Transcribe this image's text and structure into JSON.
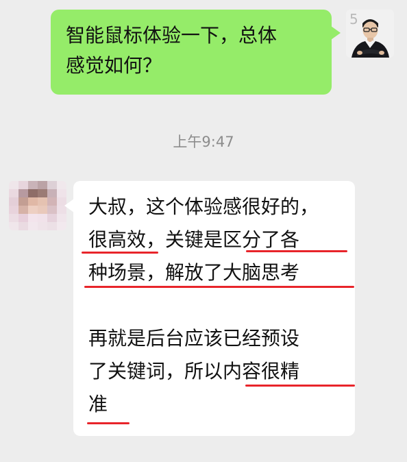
{
  "messages": {
    "outgoing": {
      "lines": [
        "智能鼠标体验一下，总体",
        "感觉如何？"
      ],
      "avatar_badge": "5"
    },
    "timestamp": "上午9:47",
    "incoming": {
      "lines": [
        "大叔，这个体验感很好的，",
        "很高效，关键是区分了各",
        "种场景，解放了大脑思考",
        "再就是后台应该已经预设",
        "了关键词，所以内容很精",
        "准"
      ]
    }
  },
  "icons": {
    "user_avatar": "person-photo-avatar",
    "contact_avatar": "pixelated-avatar"
  },
  "colors": {
    "background": "#ededed",
    "outgoing_bubble": "#95ec69",
    "incoming_bubble": "#ffffff",
    "timestamp_text": "#8c8c8c",
    "annotation": "#e8242a"
  }
}
